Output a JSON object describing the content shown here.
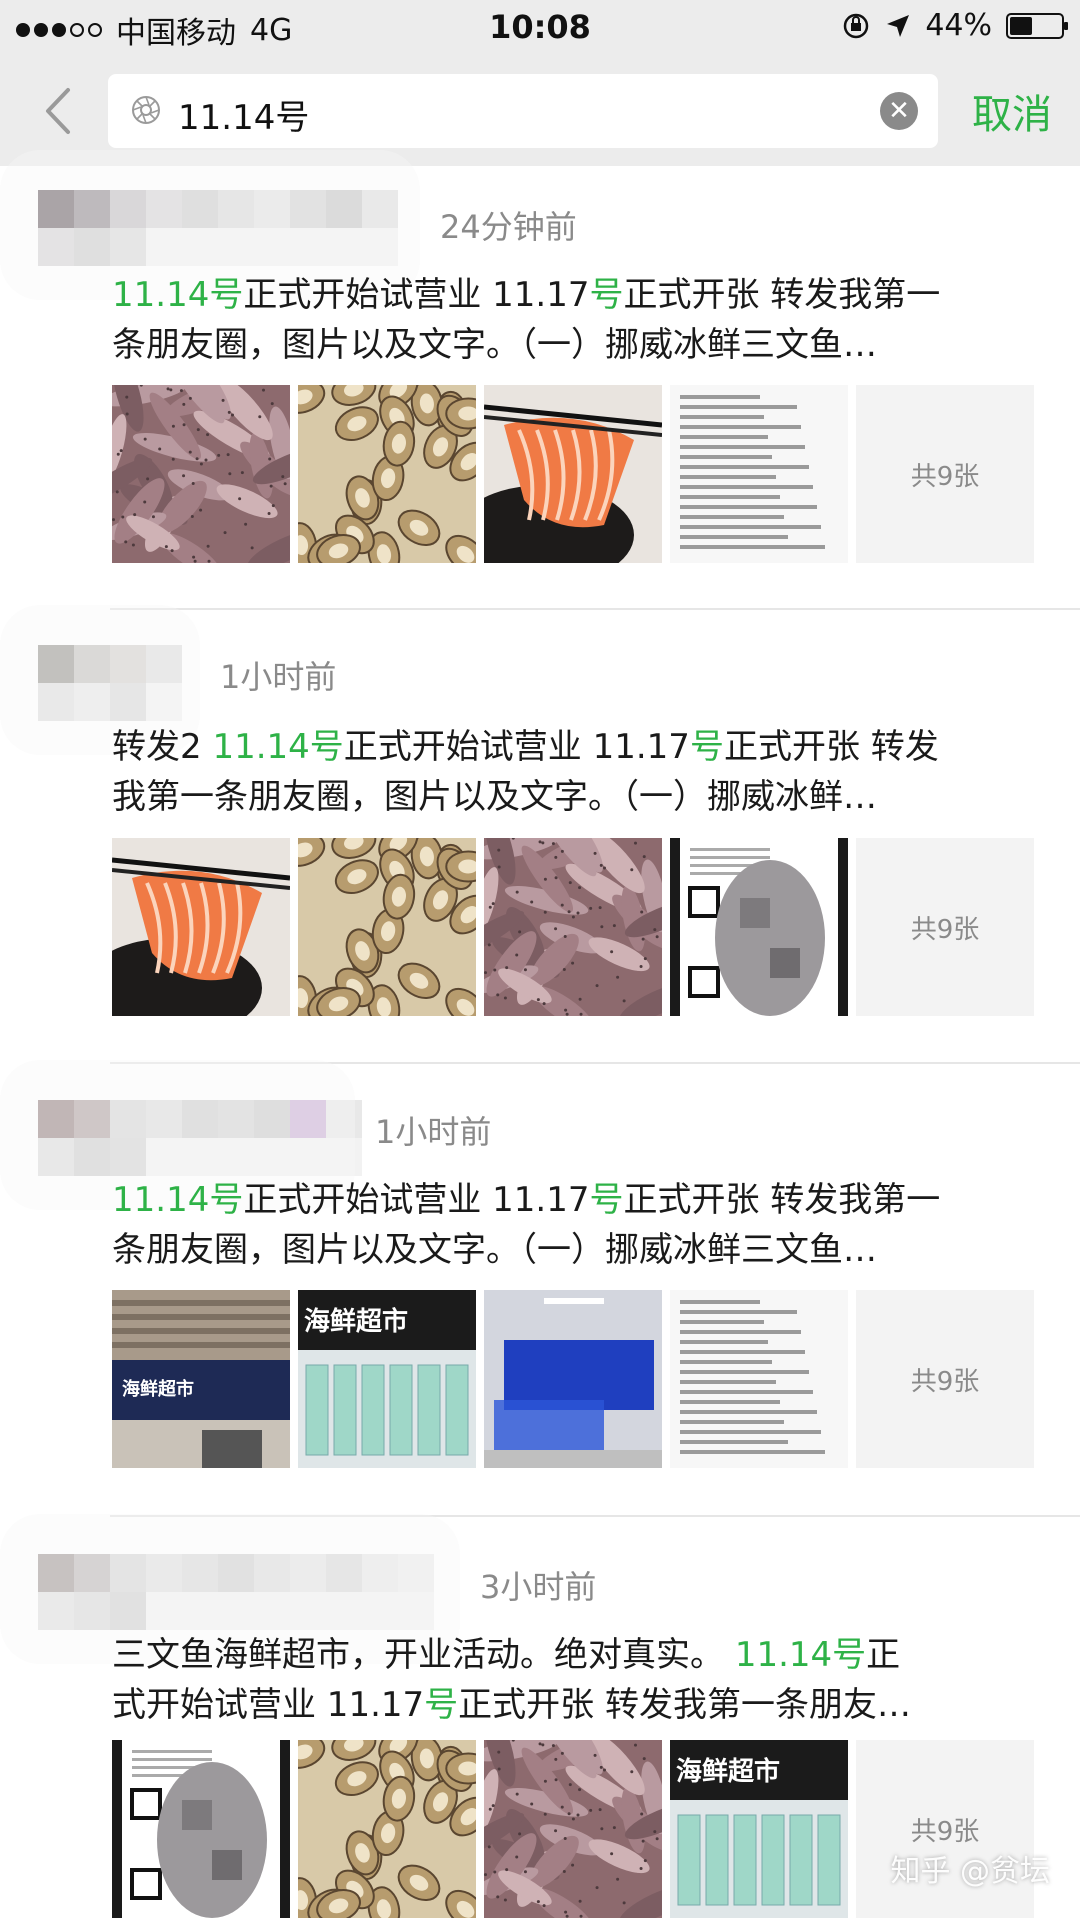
{
  "status_bar": {
    "carrier": "中国移动",
    "network": "4G",
    "time": "10:08",
    "battery_percent": 44,
    "battery_label": "44%"
  },
  "search": {
    "query": "11.14号",
    "cancel_label": "取消"
  },
  "results": [
    {
      "time_ago": "24分钟前",
      "text_lines": [
        [
          {
            "t": "11.14号",
            "hl": true
          },
          {
            "t": "正式开始试营业 11.17",
            "hl": false
          },
          {
            "t": "号",
            "hl": true
          },
          {
            "t": "正式开张 转发我第一",
            "hl": false
          }
        ],
        [
          {
            "t": "条朋友圈，图片以及文字。（一）挪威冰鲜三文鱼…",
            "hl": false
          }
        ]
      ],
      "thumbs": [
        "fish-pile",
        "snails",
        "salmon-slice",
        "price-list"
      ],
      "more_label": "共9张"
    },
    {
      "time_ago": "1小时前",
      "text_lines": [
        [
          {
            "t": "转发2 ",
            "hl": false
          },
          {
            "t": "11.14号",
            "hl": true
          },
          {
            "t": "正式开始试营业 11.17",
            "hl": false
          },
          {
            "t": "号",
            "hl": true
          },
          {
            "t": "正式开张 转发",
            "hl": false
          }
        ],
        [
          {
            "t": "我第一条朋友圈，图片以及文字。（一）挪威冰鲜…",
            "hl": false
          }
        ]
      ],
      "thumbs": [
        "salmon-slice",
        "snails",
        "fish-pile",
        "qr-screenshot"
      ],
      "more_label": "共9张"
    },
    {
      "time_ago": "1小时前",
      "text_lines": [
        [
          {
            "t": "11.14号",
            "hl": true
          },
          {
            "t": "正式开始试营业 11.17",
            "hl": false
          },
          {
            "t": "号",
            "hl": true
          },
          {
            "t": "正式开张 转发我第一",
            "hl": false
          }
        ],
        [
          {
            "t": "条朋友圈，图片以及文字。（一）挪威冰鲜三文鱼…",
            "hl": false
          }
        ]
      ],
      "thumbs": [
        "storefront",
        "store-sign",
        "aquarium-tanks",
        "price-list"
      ],
      "more_label": "共9张"
    },
    {
      "time_ago": "3小时前",
      "text_lines": [
        [
          {
            "t": "三文鱼海鲜超市，开业活动。绝对真实。 ",
            "hl": false
          },
          {
            "t": "11.14号",
            "hl": true
          },
          {
            "t": "正",
            "hl": false
          }
        ],
        [
          {
            "t": "式开始试营业 11.17",
            "hl": false
          },
          {
            "t": "号",
            "hl": true
          },
          {
            "t": "正式开张 转发我第一条朋友…",
            "hl": false
          }
        ]
      ],
      "thumbs": [
        "qr-screenshot",
        "snails",
        "fish-pile",
        "store-sign"
      ],
      "more_label": "共9张"
    }
  ],
  "thumb_text": {
    "store_sign": "海鲜超市",
    "storefront_sign": "海鲜超市"
  },
  "watermark": "知乎 @贫坛",
  "colors": {
    "highlight": "#2eb247",
    "gray_text": "#8a8a8a",
    "bar_bg": "#ececec"
  }
}
